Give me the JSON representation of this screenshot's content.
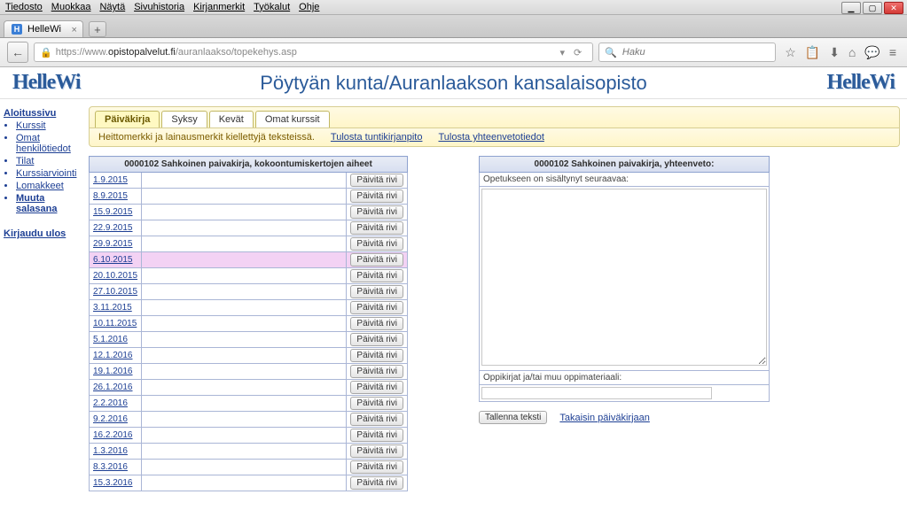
{
  "browser": {
    "menu": [
      "Tiedosto",
      "Muokkaa",
      "Näytä",
      "Sivuhistoria",
      "Kirjanmerkit",
      "Työkalut",
      "Ohje"
    ],
    "tab_title": "HelleWi",
    "tab_fav": "H",
    "url_prefix": "https://www.",
    "url_domain": "opistopalvelut.fi",
    "url_path": "/auranlaakso/topekehys.asp",
    "search_placeholder": "Haku"
  },
  "header": {
    "logo": "HelleWi",
    "title": "Pöytyän kunta/Auranlaakson kansalaisopisto"
  },
  "sidebar": {
    "top": "Aloitussivu",
    "items": [
      "Kurssit",
      "Omat henkilötiedot",
      "Tilat",
      "Kurssiarviointi",
      "Lomakkeet",
      "Muuta salasana"
    ],
    "logout": "Kirjaudu ulos"
  },
  "tabs": {
    "items": [
      {
        "label": "Päiväkirja",
        "active": true
      },
      {
        "label": "Syksy",
        "active": false
      },
      {
        "label": "Kevät",
        "active": false
      },
      {
        "label": "Omat kurssit",
        "active": false
      }
    ],
    "note": "Heittomerkki ja lainausmerkit kiellettyjä teksteissä.",
    "links": [
      "Tulosta tuntikirjanpito",
      "Tulosta yhteenvetotiedot"
    ]
  },
  "left_table": {
    "header": "0000102 Sahkoinen paivakirja, kokoontumiskertojen aiheet",
    "btn_label": "Päivitä rivi",
    "highlight_index": 5,
    "rows": [
      "1.9.2015",
      "8.9.2015",
      "15.9.2015",
      "22.9.2015",
      "29.9.2015",
      "6.10.2015",
      "20.10.2015",
      "27.10.2015",
      "3.11.2015",
      "10.11.2015",
      "5.1.2016",
      "12.1.2016",
      "19.1.2016",
      "26.1.2016",
      "2.2.2016",
      "9.2.2016",
      "16.2.2016",
      "1.3.2016",
      "8.3.2016",
      "15.3.2016"
    ]
  },
  "right_panel": {
    "header": "0000102 Sahkoinen paivakirja,  yhteenveto:",
    "label1": "Opetukseen on sisältynyt seuraavaa:",
    "label2": "Oppikirjat ja/tai muu oppimateriaali:",
    "save_btn": "Tallenna teksti",
    "back_link": "Takaisin päiväkirjaan"
  }
}
